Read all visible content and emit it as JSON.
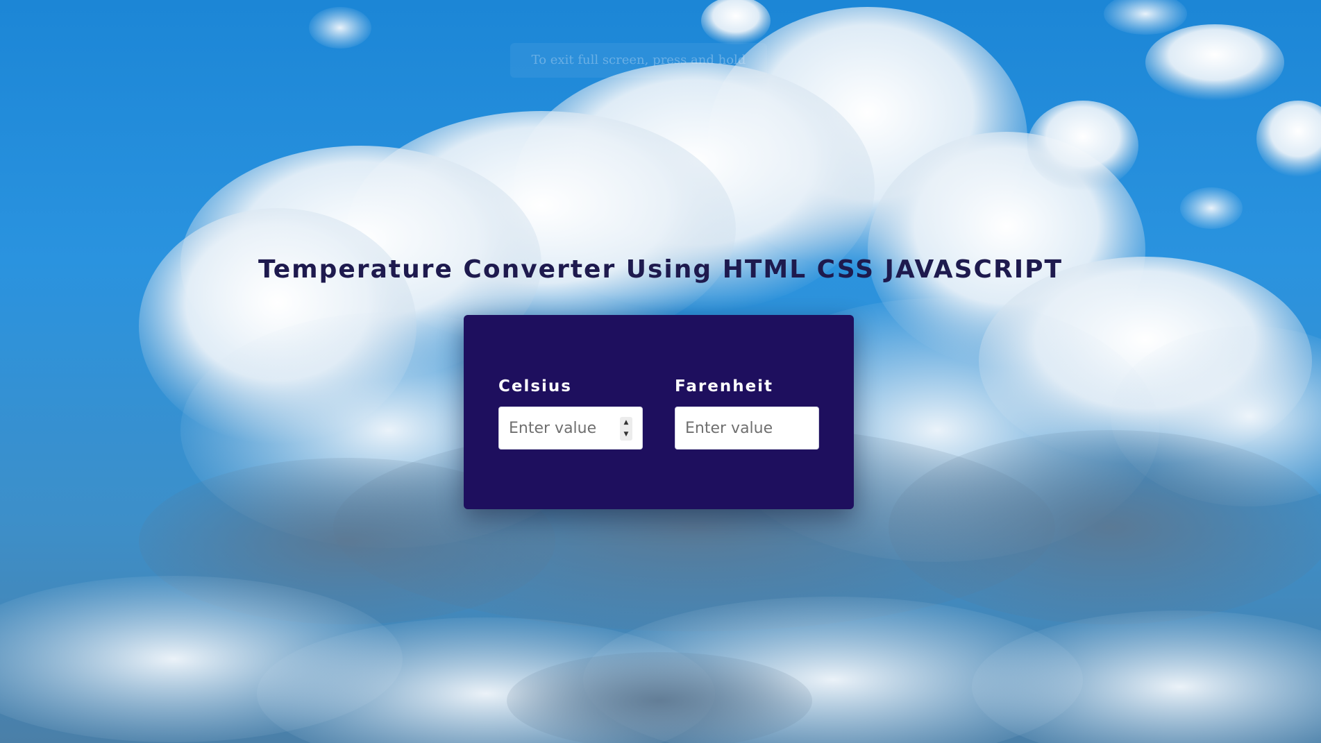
{
  "page": {
    "heading": "Temperature Converter Using HTML CSS JAVASCRIPT",
    "fullscreen_notice": "To exit full screen, press and hold"
  },
  "converter": {
    "celsius": {
      "label": "Celsius",
      "placeholder": "Enter value",
      "value": ""
    },
    "fahrenheit": {
      "label": "Farenheit",
      "placeholder": "Enter value",
      "value": ""
    },
    "spinner_icons": {
      "up": "▲",
      "down": "▼"
    }
  },
  "colors": {
    "card_background": "#1e0f5e",
    "heading_text": "#1e1a4e",
    "label_text": "#ffffff",
    "sky": "#1c86d6"
  }
}
